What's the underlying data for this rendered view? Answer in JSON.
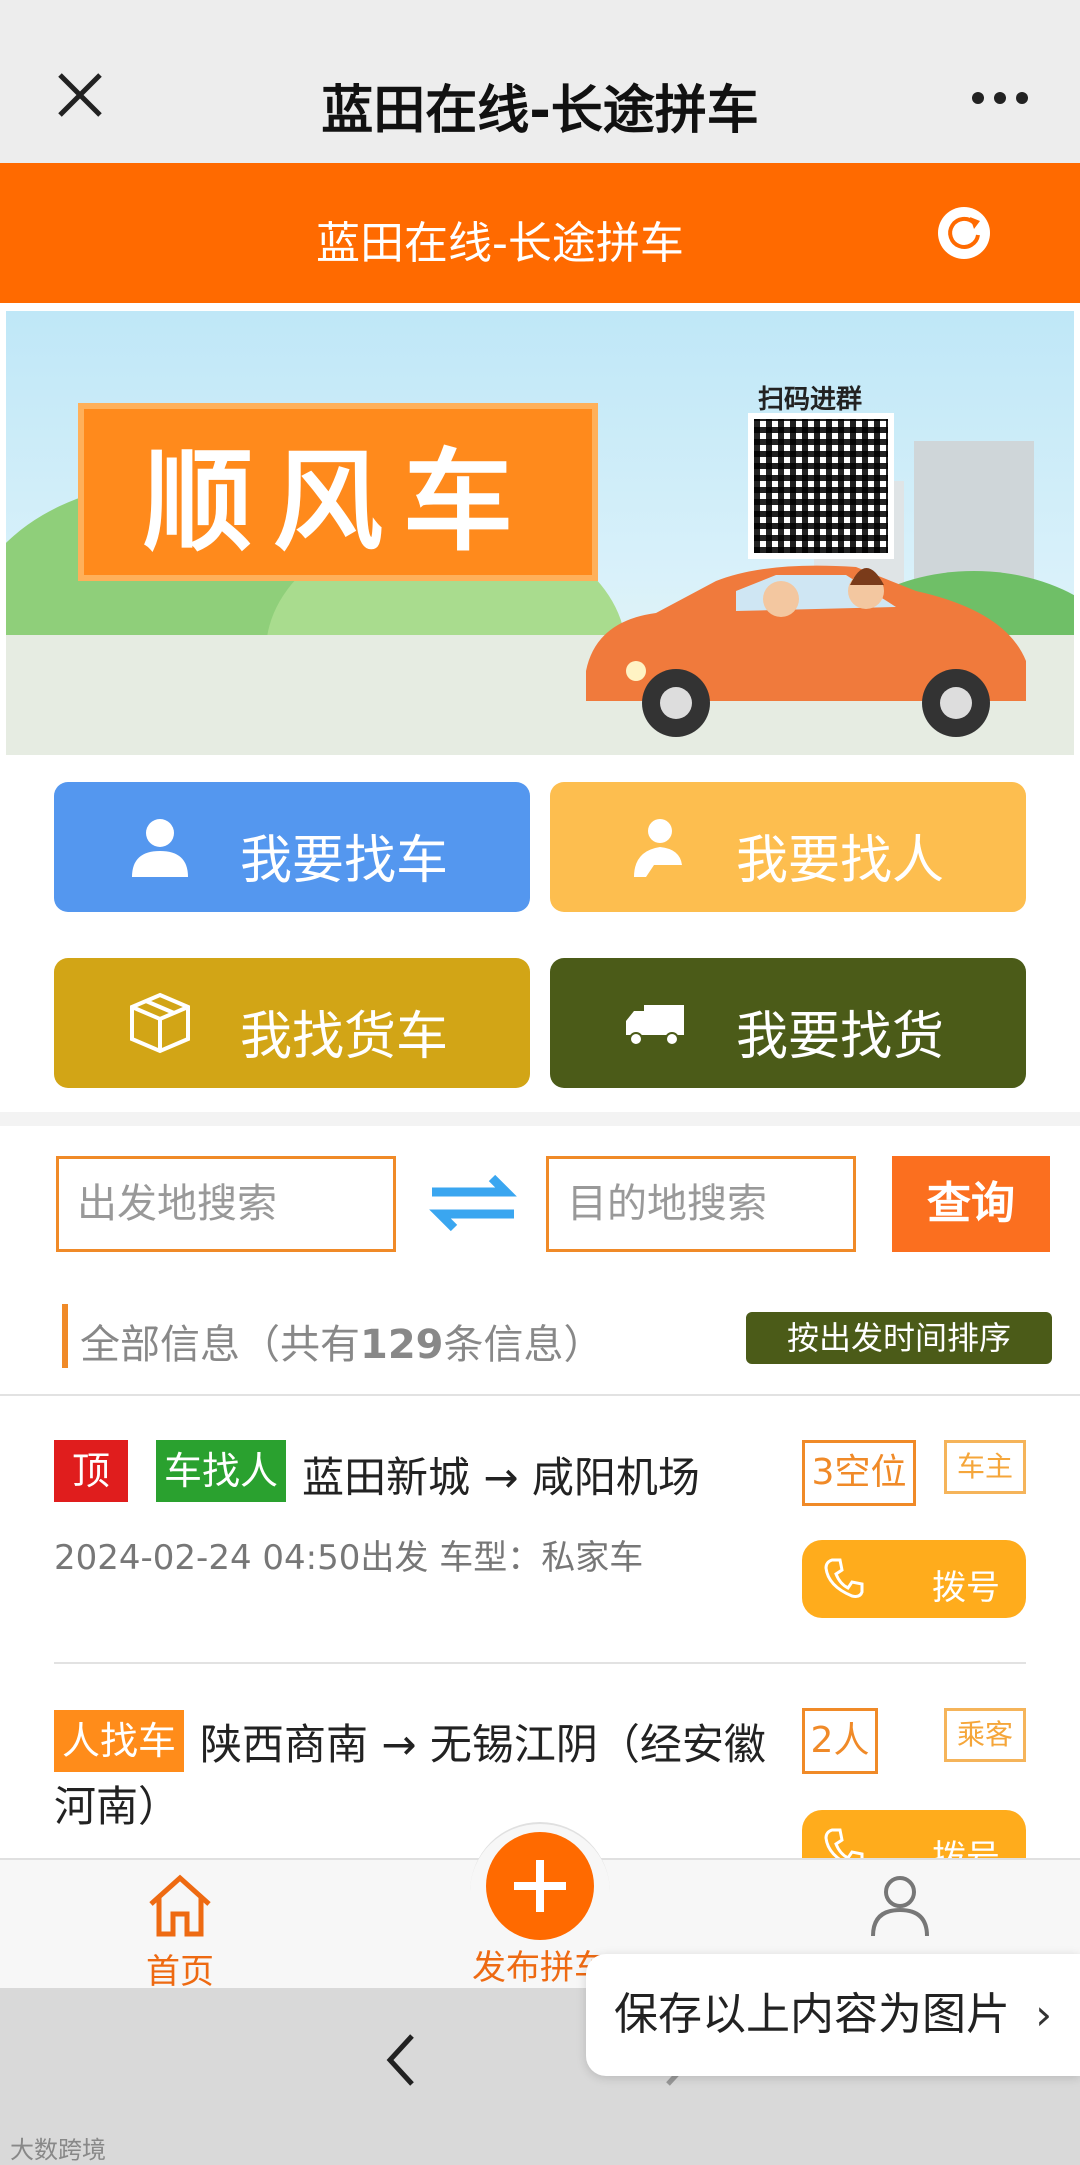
{
  "wechat_bar": {
    "title": "蓝田在线-长途拼车"
  },
  "header": {
    "title": "蓝田在线-长途拼车"
  },
  "banner": {
    "sign_text": "顺风车",
    "qr_label": "扫码进群"
  },
  "actions": [
    {
      "label": "我要找车",
      "icon": "person-icon",
      "color": "#5497ef"
    },
    {
      "label": "我要找人",
      "icon": "driver-icon",
      "color": "#fdbe4f"
    },
    {
      "label": "我找货车",
      "icon": "box-icon",
      "color": "#d2a516"
    },
    {
      "label": "我要找货",
      "icon": "truck-icon",
      "color": "#4b5b18"
    }
  ],
  "search": {
    "from_placeholder": "出发地搜索",
    "to_placeholder": "目的地搜索",
    "query_label": "查询"
  },
  "list_header": {
    "prefix": "全部信息（共有",
    "count": "129",
    "suffix": "条信息）",
    "sort_label": "按出发时间排序"
  },
  "listings": [
    {
      "pin_tag": "顶",
      "type_tag": "车找人",
      "route": "蓝田新城 → 咸阳机场",
      "meta": "2024-02-24 04:50出发 车型：私家车",
      "seats": "3空位",
      "role": "车主",
      "dial_label": "拨号"
    },
    {
      "type_tag": "人找车",
      "route": "陕西商南 → 无锡江阴（经安徽河南）",
      "seats": "2人",
      "role": "乘客",
      "dial_label": "拨号"
    }
  ],
  "tabbar": {
    "home": "首页",
    "publish": "发布拼车",
    "me": "我的"
  },
  "save_popup": {
    "label": "保存以上内容为图片",
    "chevron": "›"
  },
  "watermark": "大数跨境",
  "colors": {
    "brand_orange": "#ff6a00",
    "accent_orange": "#f08a28",
    "dark_green": "#4b5b18"
  }
}
